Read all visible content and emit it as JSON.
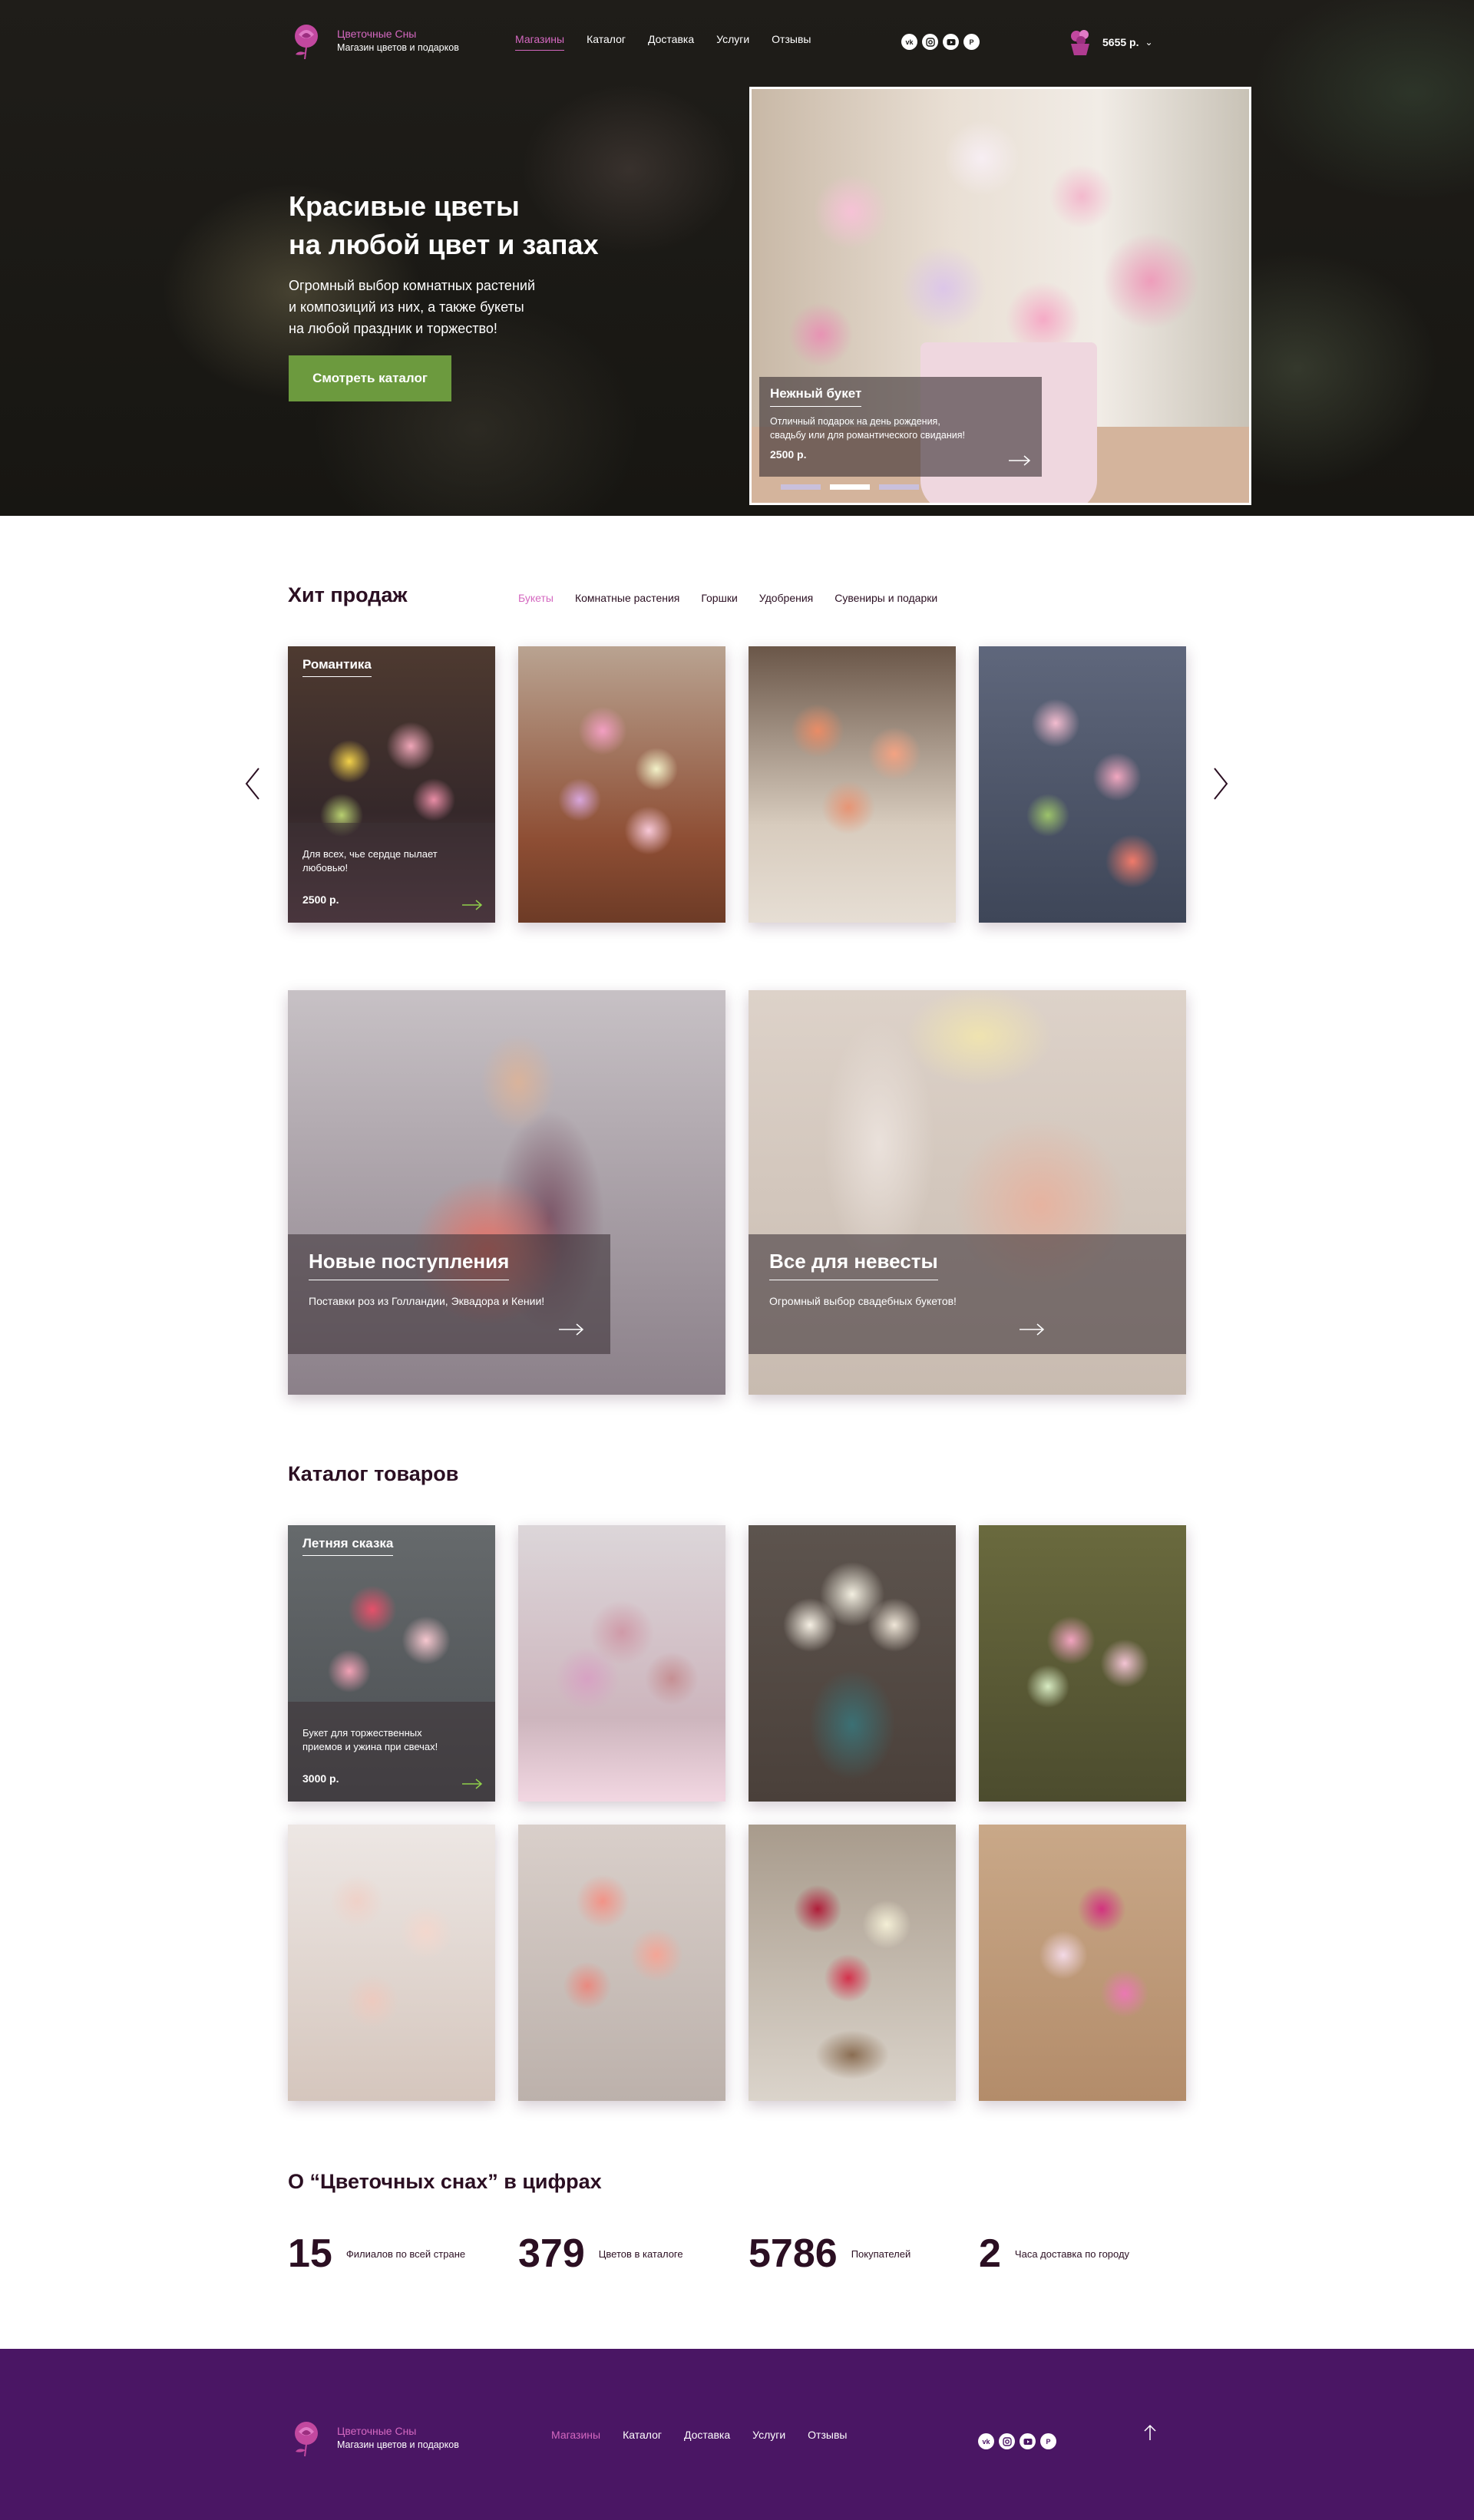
{
  "brand": {
    "title": "Цветочные Сны",
    "subtitle": "Магазин цветов и подарков",
    "accent_color": "#d468c0",
    "cta_color": "#6c9a3e",
    "footer_color": "#4a1664"
  },
  "nav": {
    "items": [
      "Магазины",
      "Каталог",
      "Доставка",
      "Услуги",
      "Отзывы"
    ],
    "active_index": 0
  },
  "socials": [
    "vk-icon",
    "instagram-icon",
    "youtube-icon",
    "pinterest-icon"
  ],
  "cart": {
    "label": "5655 р.",
    "icon": "flower-basket-icon"
  },
  "hero": {
    "title_line1": "Красивые цветы",
    "title_line2": "на любой цвет и запах",
    "text_line1": "Огромный выбор комнатных растений",
    "text_line2": "и композиций из них, а также букеты",
    "text_line3": "на любой праздник и торжество!",
    "button": "Смотреть каталог",
    "slide": {
      "title": "Нежный букет",
      "desc_line1": "Отличный подарок на день рождения,",
      "desc_line2": "свадьбу или для романтического свидания!",
      "price": "2500 р."
    },
    "slides_count": 3,
    "active_slide": 1
  },
  "hits": {
    "heading": "Хит продаж",
    "tabs": [
      "Букеты",
      "Комнатные растения",
      "Горшки",
      "Удобрения",
      "Сувениры и подарки"
    ],
    "active_tab": 0,
    "featured": {
      "title": "Романтика",
      "desc_line1": "Для всех, чье сердце пылает",
      "desc_line2": "любовью!",
      "price": "2500 р."
    }
  },
  "promos": [
    {
      "title": "Новые поступления",
      "desc": "Поставки роз из Голландии, Эквадора и Кении!"
    },
    {
      "title": "Все для невесты",
      "desc": "Огромный выбор свадебных букетов!"
    }
  ],
  "catalog": {
    "heading": "Каталог товаров",
    "featured": {
      "title": "Летняя сказка",
      "desc_line1": "Букет для торжественных",
      "desc_line2": "приемов и ужина при свечах!",
      "price": "3000 р."
    }
  },
  "stats": {
    "heading": "О “Цветочных снах” в цифрах",
    "items": [
      {
        "num": "15",
        "label": "Филиалов по всей стране"
      },
      {
        "num": "379",
        "label": "Цветов в каталоге"
      },
      {
        "num": "5786",
        "label": "Покупателей"
      },
      {
        "num": "2",
        "label": "Часа доставка по городу"
      }
    ]
  },
  "footer": {
    "title": "Цветочные Сны",
    "subtitle": "Магазин цветов и подарков",
    "nav": [
      "Магазины",
      "Каталог",
      "Доставка",
      "Услуги",
      "Отзывы"
    ],
    "scroll_top_icon": "arrow-up-icon"
  }
}
